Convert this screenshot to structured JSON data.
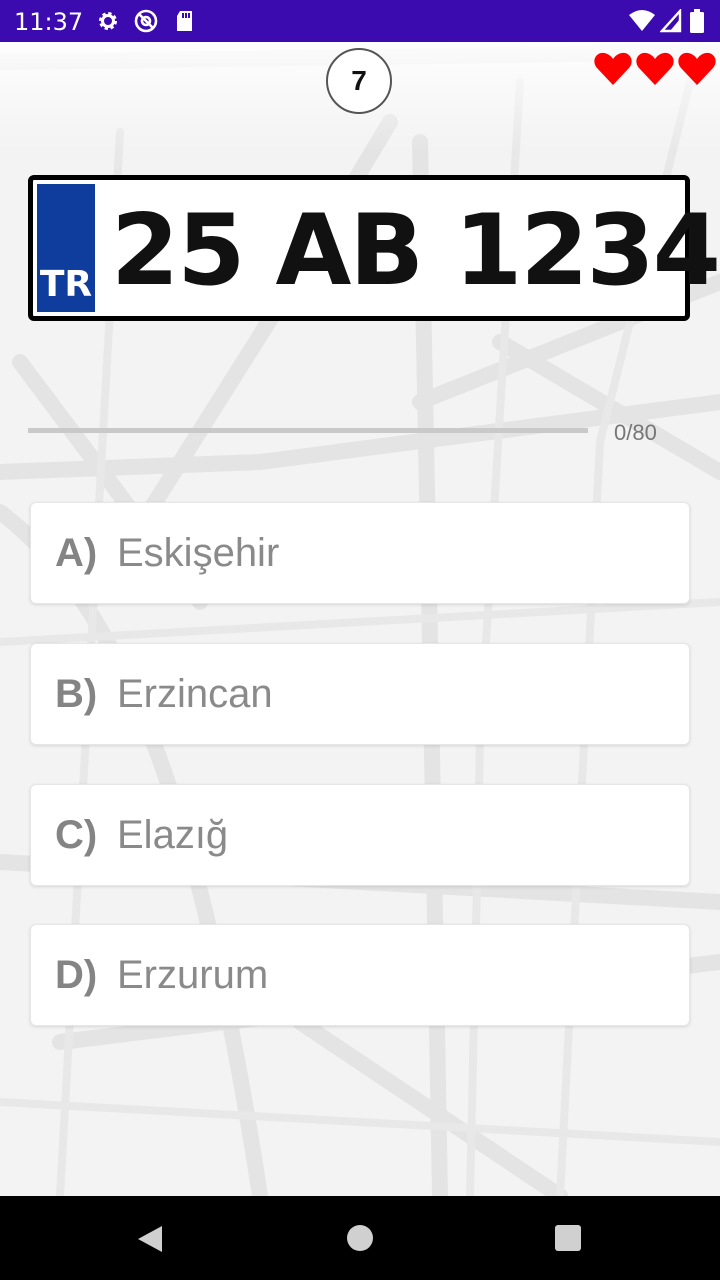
{
  "status": {
    "time": "11:37",
    "icons": [
      "gear-icon",
      "at-sign-icon",
      "sd-card-icon",
      "wifi-icon",
      "signal-icon",
      "battery-icon"
    ],
    "color": "#3b0bb0"
  },
  "game": {
    "timer": "7",
    "lives": 3,
    "heart_color": "#ff0000"
  },
  "plate": {
    "country": "TR",
    "number": "25 AB 1234",
    "band_color": "#0f3d9e"
  },
  "progress": {
    "current": 0,
    "total": 80,
    "label": "0/80"
  },
  "options": [
    {
      "letter": "A)",
      "text": "Eskişehir"
    },
    {
      "letter": "B)",
      "text": "Erzincan"
    },
    {
      "letter": "C)",
      "text": "Elazığ"
    },
    {
      "letter": "D)",
      "text": "Erzurum"
    }
  ],
  "nav": {
    "icons": [
      "back-icon",
      "home-icon",
      "recents-icon"
    ]
  }
}
